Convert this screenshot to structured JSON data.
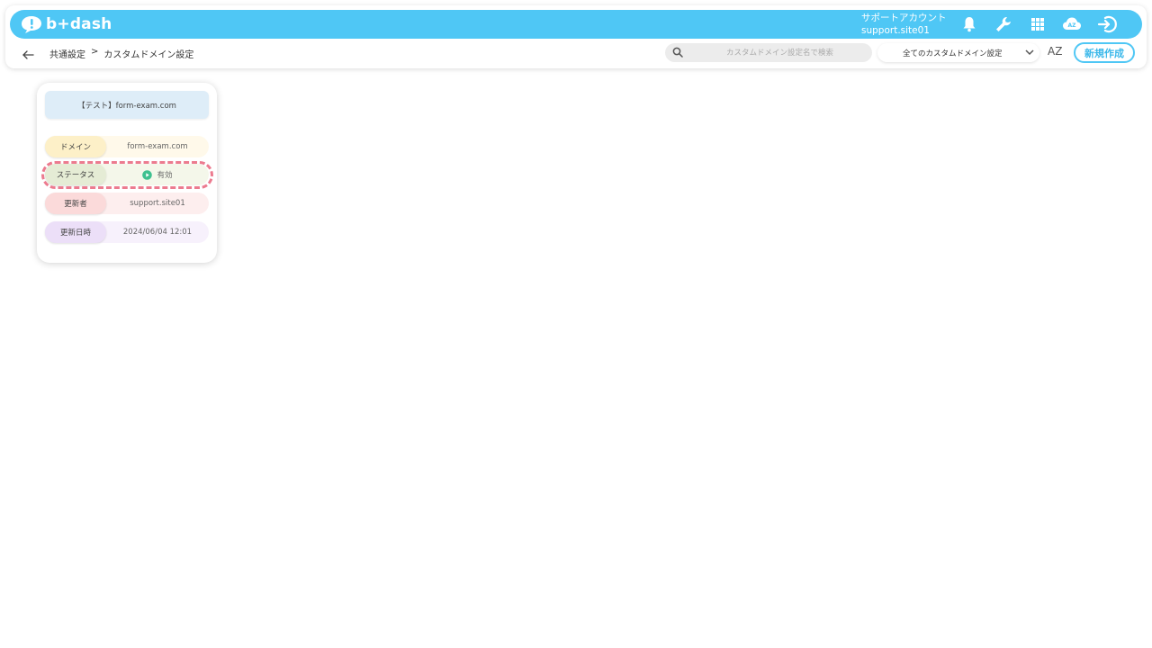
{
  "app": {
    "logo_text": "b+dash"
  },
  "header": {
    "account_label": "サポートアカウント",
    "account_id": "support.site01",
    "icons": [
      "bell-icon",
      "wrench-icon",
      "grid-icon",
      "az-cloud-icon",
      "logout-icon"
    ]
  },
  "subbar": {
    "breadcrumb": [
      "共通設定",
      ">",
      "カスタムドメイン設定"
    ],
    "search_placeholder": "カスタムドメイン設定名で検索",
    "filter_value": "全てのカスタムドメイン設定",
    "sort_label": "AZ",
    "new_button": "新規作成"
  },
  "card": {
    "title": "【テスト】form-exam.com",
    "rows": [
      {
        "label": "ドメイン",
        "value": "form-exam.com"
      },
      {
        "label": "ステータス",
        "value": "有効"
      },
      {
        "label": "更新者",
        "value": "support.site01"
      },
      {
        "label": "更新日時",
        "value": "2024/06/04 12:01"
      }
    ]
  },
  "colors": {
    "brand": "#4fc7f5",
    "status_active": "#3ec08f",
    "highlight": "#ec7b8f"
  }
}
